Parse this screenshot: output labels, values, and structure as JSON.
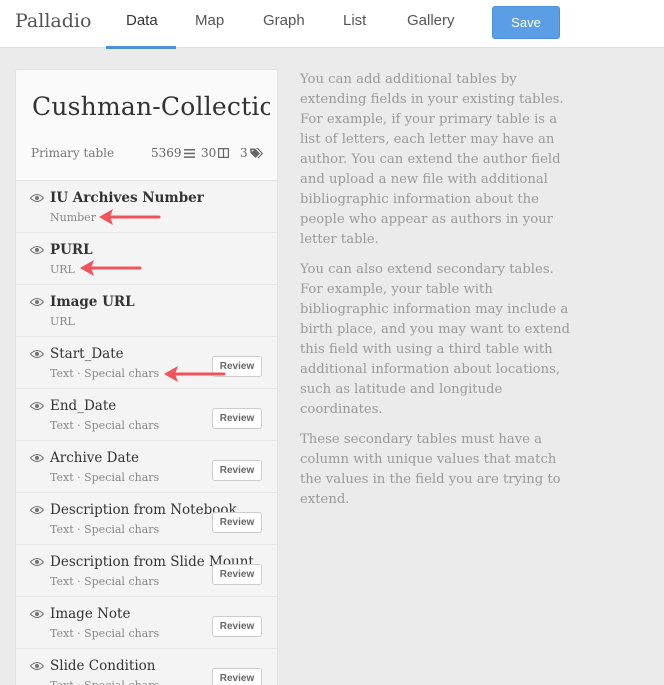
{
  "nav": {
    "brand": "Palladio",
    "tabs": [
      {
        "label": "Data"
      },
      {
        "label": "Map"
      },
      {
        "label": "Graph"
      },
      {
        "label": "List"
      },
      {
        "label": "Gallery"
      }
    ],
    "save_label": "Save"
  },
  "table": {
    "title": "Cushman-Collection",
    "primary_label": "Primary table",
    "rows_count": "5369",
    "columns_count": "30",
    "tags_count": "3"
  },
  "fields": [
    {
      "name": "IU Archives Number",
      "type": "Number",
      "review": ""
    },
    {
      "name": "PURL",
      "type": "URL",
      "review": ""
    },
    {
      "name": "Image URL",
      "type": "URL",
      "review": ""
    },
    {
      "name": "Start_Date",
      "type": "Text · Special chars",
      "review": "Review"
    },
    {
      "name": "End_Date",
      "type": "Text · Special chars",
      "review": "Review"
    },
    {
      "name": "Archive Date",
      "type": "Text · Special chars",
      "review": "Review"
    },
    {
      "name": "Description from Notebook",
      "type": "Text · Special chars",
      "review": "Review"
    },
    {
      "name": "Description from Slide Mount",
      "type": "Text · Special chars",
      "review": "Review"
    },
    {
      "name": "Image Note",
      "type": "Text · Special chars",
      "review": "Review"
    },
    {
      "name": "Slide Condition",
      "type": "Text · Special chars",
      "review": "Review"
    }
  ],
  "info": {
    "p1": "You can add additional tables by extending fields in your existing tables. For example, if your primary table is a list of letters, each letter may have an author. You can extend the author field and upload a new file with additional bibliographic information about the people who appear as authors in your letter table.",
    "p2": "You can also extend secondary tables. For example, your table with bibliographic information may include a birth place, and you may want to extend this field with using a third table with additional information about locations, such as latitude and longitude coordinates.",
    "p3": "These secondary tables must have a column with unique values that match the values in the field you are trying to extend."
  },
  "colors": {
    "accent": "#5b9ee6",
    "arrow": "#f0535a"
  }
}
